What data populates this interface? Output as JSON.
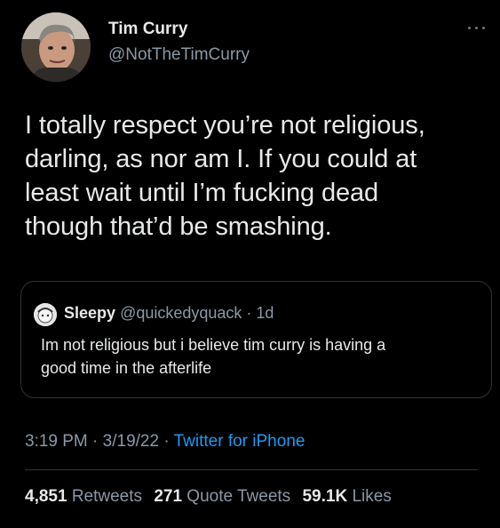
{
  "author": {
    "display_name": "Tim Curry",
    "handle": "@NotTheTimCurry",
    "avatar_icon": "profile-photo"
  },
  "menu_icon": "more-horizontal-icon",
  "tweet": {
    "line1": "I totally respect you’re not religious,",
    "line2": "darling, as nor am I. If you could at",
    "line3": "least wait until I’m fucking dead",
    "line4": "though that’d be smashing."
  },
  "quoted_tweet": {
    "avatar_icon": "profile-photo",
    "display_name": "Sleepy",
    "handle": "@quickedyquack",
    "separator": " · ",
    "age": "1d",
    "line1": "Im not religious but i believe tim curry is having a",
    "line2": "good time in the afterlife"
  },
  "meta": {
    "time": "3:19 PM",
    "separator": " · ",
    "date": "3/19/22",
    "separator2": " · ",
    "source": "Twitter for iPhone"
  },
  "stats": {
    "retweets_count": "4,851",
    "retweets_label": "Retweets",
    "quotes_count": "271",
    "quotes_label": "Quote Tweets",
    "likes_count": "59.1K",
    "likes_label": "Likes"
  },
  "colors": {
    "background": "#000000",
    "primary_text": "#e7e9ea",
    "secondary_text": "#8b98a5",
    "link": "#1d9bf0",
    "border": "#2f3336"
  }
}
